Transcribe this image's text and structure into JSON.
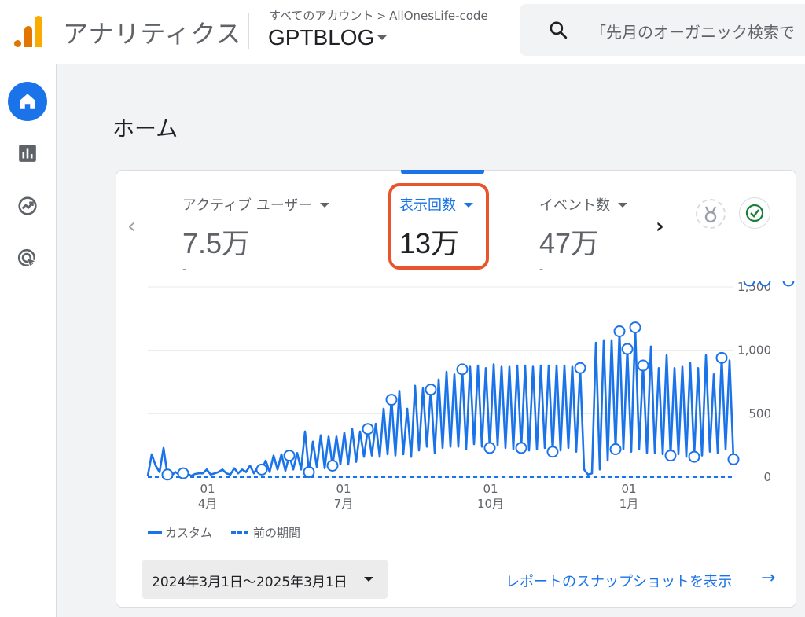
{
  "header": {
    "app_title": "アナリティクス",
    "breadcrumb": {
      "account_prefix": "すべてのアカウント",
      "account": "AllOnesLife-code"
    },
    "property": "GPTBLOG",
    "search_placeholder": "「先月のオーガニック検索で"
  },
  "sidebar": {
    "items": [
      {
        "name": "home",
        "icon": "home-icon",
        "active": true
      },
      {
        "name": "reports",
        "icon": "bar-chart-icon",
        "active": false
      },
      {
        "name": "explore",
        "icon": "explore-icon",
        "active": false
      },
      {
        "name": "advertising",
        "icon": "target-icon",
        "active": false
      }
    ]
  },
  "page": {
    "title": "ホーム"
  },
  "metrics": [
    {
      "label": "アクティブ ユーザー",
      "value": "7.5万",
      "delta": "-",
      "selected": false
    },
    {
      "label": "表示回数",
      "value": "13万",
      "delta": "",
      "selected": true
    },
    {
      "label": "イベント数",
      "value": "47万",
      "delta": "-",
      "selected": false
    }
  ],
  "colors": {
    "accent": "#1a73e8",
    "highlight": "#e8542d"
  },
  "chart_data": {
    "type": "line",
    "series": [
      {
        "name": "カスタム",
        "style": "solid",
        "values": [
          10,
          180,
          90,
          40,
          230,
          20,
          10,
          40,
          20,
          30,
          30,
          10,
          25,
          30,
          30,
          60,
          20,
          30,
          40,
          60,
          30,
          20,
          70,
          30,
          60,
          40,
          90,
          30,
          80,
          60,
          130,
          40,
          170,
          60,
          180,
          50,
          170,
          60,
          190,
          60,
          360,
          40,
          280,
          80,
          330,
          70,
          320,
          90,
          320,
          100,
          350,
          100,
          380,
          120,
          360,
          160,
          380,
          170,
          420,
          160,
          540,
          180,
          610,
          170,
          680,
          180,
          540,
          160,
          720,
          210,
          700,
          240,
          690,
          190,
          770,
          230,
          830,
          240,
          810,
          240,
          850,
          220,
          870,
          260,
          880,
          240,
          860,
          230,
          890,
          250,
          870,
          230,
          870,
          220,
          880,
          230,
          880,
          210,
          870,
          220,
          880,
          230,
          880,
          200,
          880,
          210,
          880,
          230,
          870,
          200,
          860,
          60,
          20,
          30,
          1060,
          60,
          1080,
          130,
          1080,
          220,
          1150,
          220,
          1010,
          200,
          1180,
          220,
          880,
          190,
          1030,
          190,
          860,
          180,
          960,
          170,
          860,
          180,
          870,
          160,
          900,
          160,
          860,
          170,
          960,
          200,
          810,
          190,
          940,
          220,
          920,
          140
        ],
        "markers": [
          5,
          9,
          29,
          36,
          41,
          47,
          56,
          62,
          72,
          80,
          87,
          95,
          103,
          110,
          119,
          120,
          122,
          124,
          126,
          133,
          139,
          146,
          149,
          153,
          157,
          163,
          170
        ]
      },
      {
        "name": "前の期間",
        "style": "dashed",
        "values": [
          0,
          0
        ]
      }
    ],
    "x_ticks": [
      {
        "day": "01",
        "month": "4月"
      },
      {
        "day": "01",
        "month": "7月"
      },
      {
        "day": "01",
        "month": "10月"
      },
      {
        "day": "01",
        "month": "1月"
      }
    ],
    "y_ticks": [
      "1,500",
      "1,000",
      "500",
      "0"
    ],
    "ylim": [
      0,
      1500
    ],
    "grid": true
  },
  "footer": {
    "date_range": "2024年3月1日～2025年3月1日",
    "snapshot_link": "レポートのスナップショットを表示"
  }
}
